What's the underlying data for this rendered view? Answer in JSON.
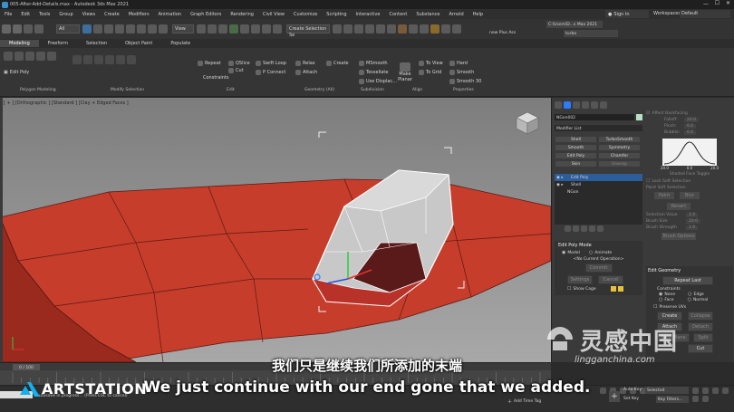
{
  "window": {
    "title": "005-After-Add-Details.max - Autodesk 3ds Max 2021",
    "sign_in": "Sign In",
    "workspace_label": "Workspaces:",
    "workspace_value": "Default"
  },
  "menu": [
    "File",
    "Edit",
    "Tools",
    "Group",
    "Views",
    "Create",
    "Modifiers",
    "Animation",
    "Graph Editors",
    "Rendering",
    "Civil View",
    "Customize",
    "Scripting",
    "Interactive",
    "Content",
    "Substance",
    "Arnold",
    "Help"
  ],
  "toolbar": {
    "filter": "All",
    "view": "View",
    "selection_set": "Create Selection Se",
    "path": "C:\\Users\\D...s Max 2021",
    "project": "new Plus Ass",
    "plugin": "turbo"
  },
  "ribbon_tabs": [
    "Modeling",
    "Freeform",
    "Selection",
    "Object Paint",
    "Populate"
  ],
  "ribbon": {
    "edit_poly": "Edit Poly",
    "repeat": "Repeat",
    "qslice": "QSlice",
    "swift_loop": "Swift Loop",
    "relax": "Relax",
    "create": "Create",
    "msmooth": "MSmooth",
    "to_view": "To View",
    "hard": "Hard",
    "cut": "Cut",
    "p_connect": "P Connect",
    "attach": "Attach",
    "tessellate": "Tessellate",
    "to_grid": "To Grid",
    "smooth": "Smooth",
    "constraints": "Constraints",
    "use_displac": "Use Displac...",
    "make_planar": "Make Planar",
    "smooth_30": "Smooth 30",
    "sections": [
      "Polygon Modeling",
      "Modify Selection",
      "Edit",
      "Geometry (All)",
      "Subdivision",
      "Align",
      "Properties"
    ]
  },
  "viewport": {
    "label": "[ + ] [Orthographic ] [Standard ] [Clay + Edged Faces ]"
  },
  "command_panel": {
    "object_name": "NGon002",
    "modifier_list": "Modifier List",
    "mod_buttons": [
      "Shell",
      "TurboSmooth",
      "Smooth",
      "Symmetry",
      "Edit Poly",
      "Chamfer",
      "Skin",
      "Unwrap"
    ],
    "stack": [
      "Edit Poly",
      "Shell",
      "NGon"
    ],
    "edit_poly_mode": "Edit Poly Mode",
    "model": "Model",
    "animate": "Animate",
    "no_op": "<No Current Operation>",
    "commit": "Commit",
    "settings": "Settings",
    "cancel": "Cancel",
    "show_cage": "Show Cage",
    "edit_geometry": "Edit Geometry",
    "repeat_last": "Repeat Last",
    "constraints": "Constraints",
    "none": "None",
    "edge": "Edge",
    "face": "Face",
    "normal": "Normal",
    "preserve_uvs": "Preserve UVs",
    "create": "Create",
    "collapse": "Collapse",
    "attach": "Attach",
    "detach": "Detach",
    "slice_plane": "Slice Plane",
    "split": "Split",
    "cut": "Cut",
    "soft_sel": [
      "Affect Backfacing",
      "Falloff:",
      "Pinch:",
      "Bubble:",
      "Shaded Face Toggle",
      "Lock Soft Selection",
      "Paint Soft Selection",
      "Paint",
      "Blur",
      "Revert",
      "Selection Value",
      "Brush Size",
      "Brush Strength",
      "Brush Options"
    ],
    "falloff_val": "20.0",
    "pinch_val": "0.0",
    "bubble_val": "0.0",
    "graph_ticks": [
      "20.0",
      "0.0",
      "20.0"
    ],
    "sel_val": "1.0",
    "brush_size": "20.0",
    "brush_strength": "1.0"
  },
  "timeline": {
    "frame": "0 / 100",
    "status": "Autosave in progress... (Press ESC to cancel)",
    "add_time_tag": "Add Time Tag",
    "auto_key": "Auto Key",
    "selected": "Selected",
    "set_key": "Set Key",
    "key_filters": "Key Filters..."
  },
  "subtitles": {
    "cn": "我们只是继续我们所添加的末端",
    "en": "We just continue with our end gone that we added."
  },
  "watermark": {
    "cn": "灵感中国",
    "url": "lingganchina.com",
    "brand": "ARTSTATION"
  },
  "colors": {
    "accent": "#4da6ff",
    "mesh": "#c23b2b",
    "bg": "#2b2b2b"
  }
}
